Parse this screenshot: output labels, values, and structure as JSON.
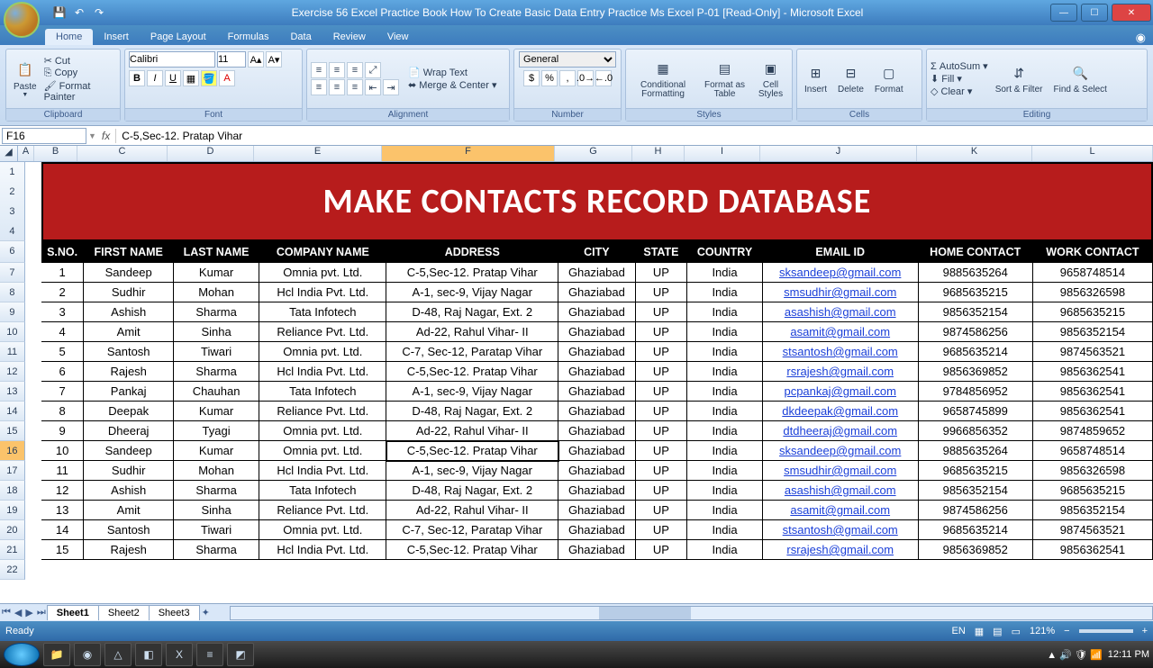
{
  "title": "Exercise 56  Excel Practice Book  How To Create Basic Data Entry Practice Ms Excel P-01  [Read-Only]  -  Microsoft Excel",
  "tabs": [
    "Home",
    "Insert",
    "Page Layout",
    "Formulas",
    "Data",
    "Review",
    "View"
  ],
  "activeTab": "Home",
  "ribbon": {
    "clipboard": {
      "label": "Clipboard",
      "paste": "Paste",
      "cut": "Cut",
      "copy": "Copy",
      "painter": "Format Painter"
    },
    "font": {
      "label": "Font",
      "name": "Calibri",
      "size": "11"
    },
    "align": {
      "label": "Alignment",
      "wrap": "Wrap Text",
      "merge": "Merge & Center"
    },
    "number": {
      "label": "Number",
      "format": "General"
    },
    "styles": {
      "label": "Styles",
      "cond": "Conditional Formatting",
      "table": "Format as Table",
      "cell": "Cell Styles"
    },
    "cells": {
      "label": "Cells",
      "insert": "Insert",
      "delete": "Delete",
      "format": "Format"
    },
    "editing": {
      "label": "Editing",
      "sum": "AutoSum",
      "fill": "Fill",
      "clear": "Clear",
      "sort": "Sort & Filter",
      "find": "Find & Select"
    }
  },
  "nameBox": "F16",
  "formula": "C-5,Sec-12. Pratap Vihar",
  "columns": [
    "A",
    "B",
    "C",
    "D",
    "E",
    "F",
    "G",
    "H",
    "I",
    "J",
    "K",
    "L"
  ],
  "selectedCol": "F",
  "selectedRowNum": 16,
  "bannerText": "MAKE CONTACTS RECORD DATABASE",
  "headers": [
    "S.NO.",
    "FIRST NAME",
    "LAST NAME",
    "COMPANY NAME",
    "ADDRESS",
    "CITY",
    "STATE",
    "COUNTRY",
    "EMAIL ID",
    "HOME CONTACT",
    "WORK CONTACT"
  ],
  "rows": [
    {
      "n": 7,
      "s": "1",
      "fn": "Sandeep",
      "ln": "Kumar",
      "co": "Omnia pvt. Ltd.",
      "ad": "C-5,Sec-12. Pratap Vihar",
      "ci": "Ghaziabad",
      "st": "UP",
      "cu": "India",
      "em": "sksandeep@gmail.com",
      "hc": "9885635264",
      "wc": "9658748514"
    },
    {
      "n": 8,
      "s": "2",
      "fn": "Sudhir",
      "ln": "Mohan",
      "co": "Hcl India Pvt. Ltd.",
      "ad": "A-1, sec-9, Vijay Nagar",
      "ci": "Ghaziabad",
      "st": "UP",
      "cu": "India",
      "em": "smsudhir@gmail.com",
      "hc": "9685635215",
      "wc": "9856326598"
    },
    {
      "n": 9,
      "s": "3",
      "fn": "Ashish",
      "ln": "Sharma",
      "co": "Tata Infotech",
      "ad": "D-48, Raj Nagar, Ext. 2",
      "ci": "Ghaziabad",
      "st": "UP",
      "cu": "India",
      "em": "asashish@gmail.com",
      "hc": "9856352154",
      "wc": "9685635215"
    },
    {
      "n": 10,
      "s": "4",
      "fn": "Amit",
      "ln": "Sinha",
      "co": "Reliance Pvt. Ltd.",
      "ad": "Ad-22, Rahul Vihar- II",
      "ci": "Ghaziabad",
      "st": "UP",
      "cu": "India",
      "em": "asamit@gmail.com",
      "hc": "9874586256",
      "wc": "9856352154"
    },
    {
      "n": 11,
      "s": "5",
      "fn": "Santosh",
      "ln": "Tiwari",
      "co": "Omnia pvt. Ltd.",
      "ad": "C-7, Sec-12, Paratap Vihar",
      "ci": "Ghaziabad",
      "st": "UP",
      "cu": "India",
      "em": "stsantosh@gmail.com",
      "hc": "9685635214",
      "wc": "9874563521"
    },
    {
      "n": 12,
      "s": "6",
      "fn": "Rajesh",
      "ln": "Sharma",
      "co": "Hcl India Pvt. Ltd.",
      "ad": "C-5,Sec-12. Pratap Vihar",
      "ci": "Ghaziabad",
      "st": "UP",
      "cu": "India",
      "em": "rsrajesh@gmail.com",
      "hc": "9856369852",
      "wc": "9856362541"
    },
    {
      "n": 13,
      "s": "7",
      "fn": "Pankaj",
      "ln": "Chauhan",
      "co": "Tata Infotech",
      "ad": "A-1, sec-9, Vijay Nagar",
      "ci": "Ghaziabad",
      "st": "UP",
      "cu": "India",
      "em": "pcpankaj@gmail.com",
      "hc": "9784856952",
      "wc": "9856362541"
    },
    {
      "n": 14,
      "s": "8",
      "fn": "Deepak",
      "ln": "Kumar",
      "co": "Reliance Pvt. Ltd.",
      "ad": "D-48, Raj Nagar, Ext. 2",
      "ci": "Ghaziabad",
      "st": "UP",
      "cu": "India",
      "em": "dkdeepak@gmail.com",
      "hc": "9658745899",
      "wc": "9856362541"
    },
    {
      "n": 15,
      "s": "9",
      "fn": "Dheeraj",
      "ln": "Tyagi",
      "co": "Omnia pvt. Ltd.",
      "ad": "Ad-22, Rahul Vihar- II",
      "ci": "Ghaziabad",
      "st": "UP",
      "cu": "India",
      "em": "dtdheeraj@gmail.com",
      "hc": "9966856352",
      "wc": "9874859652"
    },
    {
      "n": 16,
      "s": "10",
      "fn": "Sandeep",
      "ln": "Kumar",
      "co": "Omnia pvt. Ltd.",
      "ad": "C-5,Sec-12. Pratap Vihar",
      "ci": "Ghaziabad",
      "st": "UP",
      "cu": "India",
      "em": "sksandeep@gmail.com",
      "hc": "9885635264",
      "wc": "9658748514"
    },
    {
      "n": 17,
      "s": "11",
      "fn": "Sudhir",
      "ln": "Mohan",
      "co": "Hcl India Pvt. Ltd.",
      "ad": "A-1, sec-9, Vijay Nagar",
      "ci": "Ghaziabad",
      "st": "UP",
      "cu": "India",
      "em": "smsudhir@gmail.com",
      "hc": "9685635215",
      "wc": "9856326598"
    },
    {
      "n": 18,
      "s": "12",
      "fn": "Ashish",
      "ln": "Sharma",
      "co": "Tata Infotech",
      "ad": "D-48, Raj Nagar, Ext. 2",
      "ci": "Ghaziabad",
      "st": "UP",
      "cu": "India",
      "em": "asashish@gmail.com",
      "hc": "9856352154",
      "wc": "9685635215"
    },
    {
      "n": 19,
      "s": "13",
      "fn": "Amit",
      "ln": "Sinha",
      "co": "Reliance Pvt. Ltd.",
      "ad": "Ad-22, Rahul Vihar- II",
      "ci": "Ghaziabad",
      "st": "UP",
      "cu": "India",
      "em": "asamit@gmail.com",
      "hc": "9874586256",
      "wc": "9856352154"
    },
    {
      "n": 20,
      "s": "14",
      "fn": "Santosh",
      "ln": "Tiwari",
      "co": "Omnia pvt. Ltd.",
      "ad": "C-7, Sec-12, Paratap Vihar",
      "ci": "Ghaziabad",
      "st": "UP",
      "cu": "India",
      "em": "stsantosh@gmail.com",
      "hc": "9685635214",
      "wc": "9874563521"
    },
    {
      "n": 21,
      "s": "15",
      "fn": "Rajesh",
      "ln": "Sharma",
      "co": "Hcl India Pvt. Ltd.",
      "ad": "C-5,Sec-12. Pratap Vihar",
      "ci": "Ghaziabad",
      "st": "UP",
      "cu": "India",
      "em": "rsrajesh@gmail.com",
      "hc": "9856369852",
      "wc": "9856362541"
    }
  ],
  "emptyRow": 22,
  "sheets": [
    "Sheet1",
    "Sheet2",
    "Sheet3"
  ],
  "activeSheet": "Sheet1",
  "status": {
    "ready": "Ready",
    "lang": "EN",
    "zoom": "121%",
    "time": "12:11 PM"
  }
}
